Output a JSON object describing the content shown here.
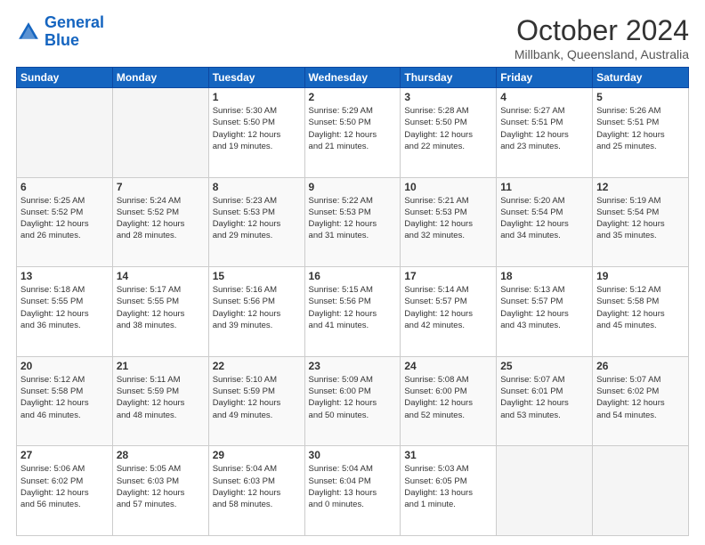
{
  "header": {
    "logo_line1": "General",
    "logo_line2": "Blue",
    "month": "October 2024",
    "location": "Millbank, Queensland, Australia"
  },
  "weekdays": [
    "Sunday",
    "Monday",
    "Tuesday",
    "Wednesday",
    "Thursday",
    "Friday",
    "Saturday"
  ],
  "weeks": [
    [
      {
        "day": "",
        "info": ""
      },
      {
        "day": "",
        "info": ""
      },
      {
        "day": "1",
        "info": "Sunrise: 5:30 AM\nSunset: 5:50 PM\nDaylight: 12 hours\nand 19 minutes."
      },
      {
        "day": "2",
        "info": "Sunrise: 5:29 AM\nSunset: 5:50 PM\nDaylight: 12 hours\nand 21 minutes."
      },
      {
        "day": "3",
        "info": "Sunrise: 5:28 AM\nSunset: 5:50 PM\nDaylight: 12 hours\nand 22 minutes."
      },
      {
        "day": "4",
        "info": "Sunrise: 5:27 AM\nSunset: 5:51 PM\nDaylight: 12 hours\nand 23 minutes."
      },
      {
        "day": "5",
        "info": "Sunrise: 5:26 AM\nSunset: 5:51 PM\nDaylight: 12 hours\nand 25 minutes."
      }
    ],
    [
      {
        "day": "6",
        "info": "Sunrise: 5:25 AM\nSunset: 5:52 PM\nDaylight: 12 hours\nand 26 minutes."
      },
      {
        "day": "7",
        "info": "Sunrise: 5:24 AM\nSunset: 5:52 PM\nDaylight: 12 hours\nand 28 minutes."
      },
      {
        "day": "8",
        "info": "Sunrise: 5:23 AM\nSunset: 5:53 PM\nDaylight: 12 hours\nand 29 minutes."
      },
      {
        "day": "9",
        "info": "Sunrise: 5:22 AM\nSunset: 5:53 PM\nDaylight: 12 hours\nand 31 minutes."
      },
      {
        "day": "10",
        "info": "Sunrise: 5:21 AM\nSunset: 5:53 PM\nDaylight: 12 hours\nand 32 minutes."
      },
      {
        "day": "11",
        "info": "Sunrise: 5:20 AM\nSunset: 5:54 PM\nDaylight: 12 hours\nand 34 minutes."
      },
      {
        "day": "12",
        "info": "Sunrise: 5:19 AM\nSunset: 5:54 PM\nDaylight: 12 hours\nand 35 minutes."
      }
    ],
    [
      {
        "day": "13",
        "info": "Sunrise: 5:18 AM\nSunset: 5:55 PM\nDaylight: 12 hours\nand 36 minutes."
      },
      {
        "day": "14",
        "info": "Sunrise: 5:17 AM\nSunset: 5:55 PM\nDaylight: 12 hours\nand 38 minutes."
      },
      {
        "day": "15",
        "info": "Sunrise: 5:16 AM\nSunset: 5:56 PM\nDaylight: 12 hours\nand 39 minutes."
      },
      {
        "day": "16",
        "info": "Sunrise: 5:15 AM\nSunset: 5:56 PM\nDaylight: 12 hours\nand 41 minutes."
      },
      {
        "day": "17",
        "info": "Sunrise: 5:14 AM\nSunset: 5:57 PM\nDaylight: 12 hours\nand 42 minutes."
      },
      {
        "day": "18",
        "info": "Sunrise: 5:13 AM\nSunset: 5:57 PM\nDaylight: 12 hours\nand 43 minutes."
      },
      {
        "day": "19",
        "info": "Sunrise: 5:12 AM\nSunset: 5:58 PM\nDaylight: 12 hours\nand 45 minutes."
      }
    ],
    [
      {
        "day": "20",
        "info": "Sunrise: 5:12 AM\nSunset: 5:58 PM\nDaylight: 12 hours\nand 46 minutes."
      },
      {
        "day": "21",
        "info": "Sunrise: 5:11 AM\nSunset: 5:59 PM\nDaylight: 12 hours\nand 48 minutes."
      },
      {
        "day": "22",
        "info": "Sunrise: 5:10 AM\nSunset: 5:59 PM\nDaylight: 12 hours\nand 49 minutes."
      },
      {
        "day": "23",
        "info": "Sunrise: 5:09 AM\nSunset: 6:00 PM\nDaylight: 12 hours\nand 50 minutes."
      },
      {
        "day": "24",
        "info": "Sunrise: 5:08 AM\nSunset: 6:00 PM\nDaylight: 12 hours\nand 52 minutes."
      },
      {
        "day": "25",
        "info": "Sunrise: 5:07 AM\nSunset: 6:01 PM\nDaylight: 12 hours\nand 53 minutes."
      },
      {
        "day": "26",
        "info": "Sunrise: 5:07 AM\nSunset: 6:02 PM\nDaylight: 12 hours\nand 54 minutes."
      }
    ],
    [
      {
        "day": "27",
        "info": "Sunrise: 5:06 AM\nSunset: 6:02 PM\nDaylight: 12 hours\nand 56 minutes."
      },
      {
        "day": "28",
        "info": "Sunrise: 5:05 AM\nSunset: 6:03 PM\nDaylight: 12 hours\nand 57 minutes."
      },
      {
        "day": "29",
        "info": "Sunrise: 5:04 AM\nSunset: 6:03 PM\nDaylight: 12 hours\nand 58 minutes."
      },
      {
        "day": "30",
        "info": "Sunrise: 5:04 AM\nSunset: 6:04 PM\nDaylight: 13 hours\nand 0 minutes."
      },
      {
        "day": "31",
        "info": "Sunrise: 5:03 AM\nSunset: 6:05 PM\nDaylight: 13 hours\nand 1 minute."
      },
      {
        "day": "",
        "info": ""
      },
      {
        "day": "",
        "info": ""
      }
    ]
  ]
}
